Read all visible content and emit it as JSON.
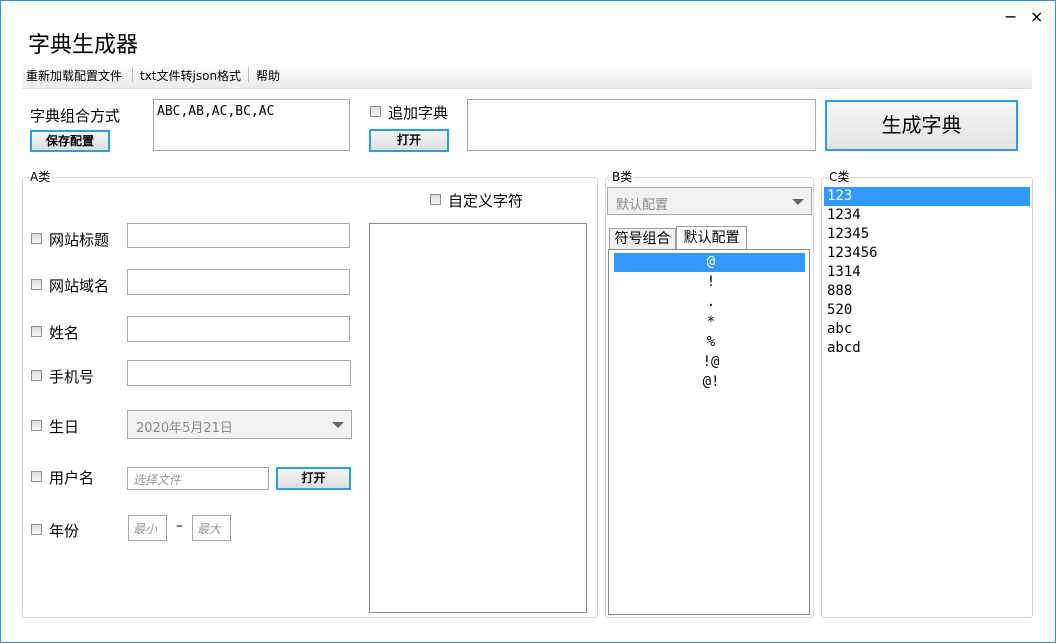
{
  "app": {
    "title": "字典生成器"
  },
  "window_controls": {
    "minimize": "−",
    "close": "×"
  },
  "menu": {
    "items": [
      "重新加载配置文件",
      "txt文件转json格式",
      "帮助"
    ]
  },
  "combo_section": {
    "label": "字典组合方式",
    "save_button": "保存配置",
    "combo_value": "ABC,AB,AC,BC,AC",
    "append_label": "追加字典",
    "open_button": "打开",
    "generate_button": "生成字典"
  },
  "group_a": {
    "title": "A类",
    "custom_chars_label": "自定义字符",
    "fields": {
      "site_title": "网站标题",
      "site_domain": "网站域名",
      "name": "姓名",
      "phone": "手机号",
      "birthday": "生日",
      "birthday_value": "2020年5月21日",
      "username": "用户名",
      "username_placeholder": "选择文件",
      "username_open": "打开",
      "year": "年份",
      "year_min_placeholder": "最小",
      "year_max_placeholder": "最大",
      "year_dash": "–"
    }
  },
  "group_b": {
    "title": "B类",
    "config_select": "默认配置",
    "tabs": [
      "符号组合",
      "默认配置"
    ],
    "symbols": [
      "@",
      "!",
      ".",
      "*",
      "%",
      "!@",
      "@!"
    ]
  },
  "group_c": {
    "title": "C类",
    "items": [
      "123",
      "1234",
      "12345",
      "123456",
      "1314",
      "888",
      "520",
      "abc",
      "abcd"
    ]
  },
  "colors": {
    "accent": "#2a9fd8",
    "selection": "#3399ff",
    "border": "#2b8ee0"
  }
}
